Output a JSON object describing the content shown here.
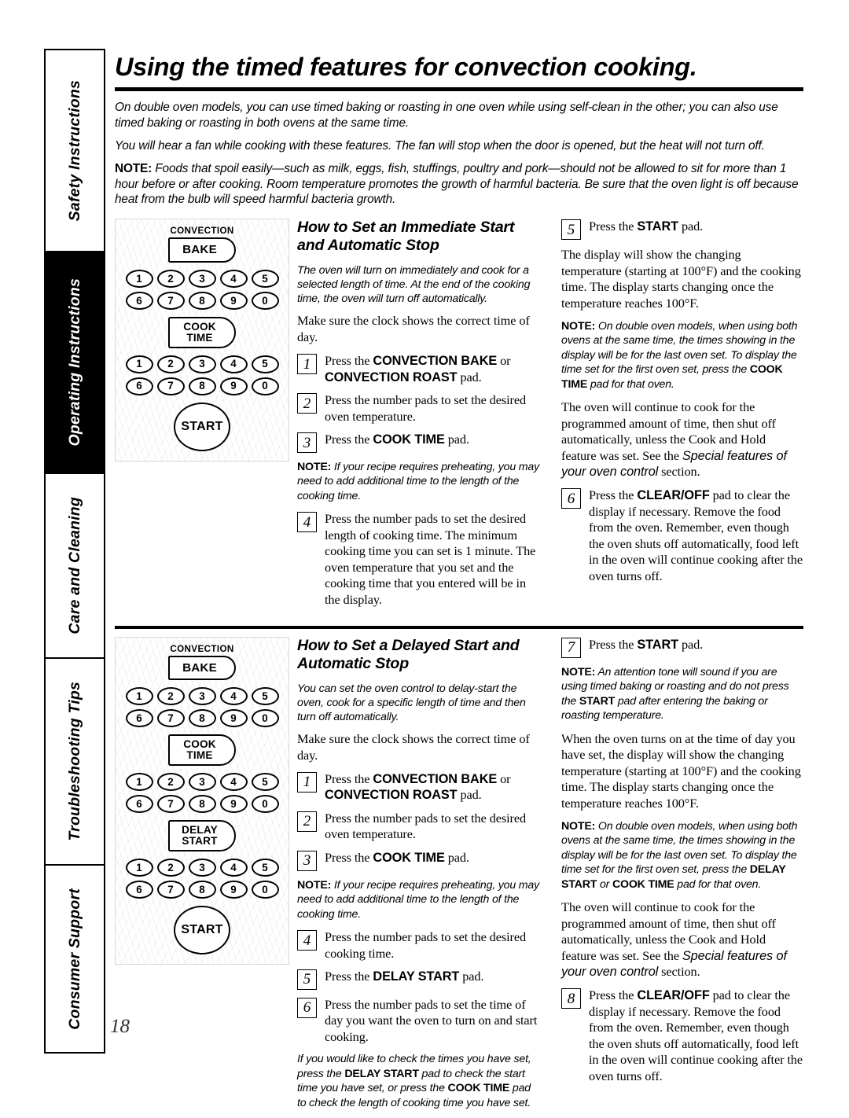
{
  "sidebar": {
    "tabs": [
      {
        "label": "Safety Instructions",
        "active": false
      },
      {
        "label": "Operating Instructions",
        "active": true
      },
      {
        "label": "Care and Cleaning",
        "active": false
      },
      {
        "label": "Troubleshooting Tips",
        "active": false
      },
      {
        "label": "Consumer Support",
        "active": false
      }
    ]
  },
  "page": {
    "title": "Using the timed features for convection cooking.",
    "number": "18"
  },
  "intro": {
    "p1": "On double oven models, you can use timed baking or roasting in one oven while using self-clean in the other; you can also use timed baking or roasting in both ovens at the same time.",
    "p2": "You will hear a fan while cooking with these features. The fan will stop when the door is opened, but the heat will not turn off.",
    "note_label": "NOTE:",
    "note_body": "Foods that spoil easily—such as milk, eggs, fish, stuffings, poultry and pork—should not be allowed to sit for more than 1 hour before or after cooking. Room temperature promotes the growth of harmful bacteria. Be sure that the oven light is off because heat from the bulb will speed harmful bacteria growth."
  },
  "section1": {
    "heading": "How to Set an Immediate Start and Automatic Stop",
    "intro_italic": "The oven will turn on immediately and cook for a selected length of time. At the end of the cooking time, the oven will turn off automatically.",
    "clock_line": "Make sure the clock shows the correct time of day.",
    "step1_num": "1",
    "step1_a": "Press the ",
    "step1_bold1": "CONVECTION BAKE",
    "step1_b": " or ",
    "step1_bold2": "CONVECTION ROAST",
    "step1_c": " pad.",
    "step2_num": "2",
    "step2_text": "Press the number pads to set the desired oven temperature.",
    "step3_num": "3",
    "step3_a": "Press the ",
    "step3_bold": "COOK TIME",
    "step3_b": " pad.",
    "note1_label": "NOTE:",
    "note1_body": "If your recipe requires preheating, you may need to add additional time to the length of the cooking time.",
    "step4_num": "4",
    "step4_text": "Press the number pads to set the desired length of cooking time. The minimum cooking time you can set is 1 minute. The oven temperature that you set and the cooking time that you entered will be in the display.",
    "step5_num": "5",
    "step5_a": "Press the ",
    "step5_bold": "START",
    "step5_b": " pad.",
    "para_display": "The display will show the changing temperature (starting at 100°F) and the cooking time. The display starts changing once the temperature reaches 100°F.",
    "note2_label": "NOTE:",
    "note2_a": "On double oven models, when using both ovens at the same time, the times showing in the display will be for the last oven set. To display the time set for the first oven set, press the ",
    "note2_bold": "COOK TIME",
    "note2_b": " pad for that oven.",
    "para_continue_a": "The oven will continue to cook for the programmed amount of time, then shut off automatically, unless the Cook and Hold feature was set. See the ",
    "para_continue_italic": "Special features of your oven control",
    "para_continue_b": " section.",
    "step6_num": "6",
    "step6_a": "Press the ",
    "step6_bold": "CLEAR/OFF",
    "step6_b": " pad to clear the display if necessary. Remove the food from the oven. Remember, even though the oven shuts off automatically, food left in the oven will continue cooking after the oven turns off."
  },
  "section2": {
    "heading": "How to Set a Delayed Start and Automatic Stop",
    "intro_italic": "You can set the oven control to delay-start the oven, cook for a specific length of time and then turn off automatically.",
    "clock_line": "Make sure the clock shows the correct time of day.",
    "step1_num": "1",
    "step1_a": "Press the ",
    "step1_bold1": "CONVECTION BAKE",
    "step1_b": " or ",
    "step1_bold2": "CONVECTION ROAST",
    "step1_c": " pad.",
    "step2_num": "2",
    "step2_text": "Press the number pads to set the desired oven temperature.",
    "step3_num": "3",
    "step3_a": "Press the ",
    "step3_bold": "COOK TIME",
    "step3_b": " pad.",
    "note1_label": "NOTE:",
    "note1_body": "If your recipe requires preheating, you may need to add additional time to the length of the cooking time.",
    "step4_num": "4",
    "step4_text": "Press the number pads to set the desired cooking time.",
    "step5_num": "5",
    "step5_a": "Press the ",
    "step5_bold": "DELAY START",
    "step5_b": " pad.",
    "step6_num": "6",
    "step6_text": "Press the number pads to set the time of day you want the oven to turn on and start cooking.",
    "check_a": "If you would like to check the times you have set, press the ",
    "check_bold1": "DELAY START",
    "check_b": " pad to check the start time you have set, or press the ",
    "check_bold2": "COOK TIME",
    "check_c": " pad to check the length of cooking time you have set.",
    "step7_num": "7",
    "step7_a": "Press the ",
    "step7_bold": "START",
    "step7_b": " pad.",
    "note2_label": "NOTE:",
    "note2_a": "An attention tone will sound if you are using timed baking or roasting and do not press the ",
    "note2_bold": "START",
    "note2_b": " pad after entering the baking or roasting temperature.",
    "para_when": "When the oven turns on at the time of day you have set, the display will show the changing temperature (starting at 100°F) and the cooking time. The display starts changing once the temperature reaches 100°F.",
    "note3_label": "NOTE:",
    "note3_a": "On double oven models, when using both ovens at the same time, the times showing in the display will be for the last oven set. To display the time set for the first oven set, press the ",
    "note3_bold1": "DELAY START",
    "note3_b": " or ",
    "note3_bold2": "COOK TIME",
    "note3_c": " pad for that oven.",
    "para_continue_a": "The oven will continue to cook for the programmed amount of time, then shut off automatically, unless the Cook and Hold feature was set. See the ",
    "para_continue_italic": "Special features of your oven control",
    "para_continue_b": " section.",
    "step8_num": "8",
    "step8_a": "Press the ",
    "step8_bold": "CLEAR/OFF",
    "step8_b": " pad to clear the display if necessary. Remove the food from the oven. Remember, even though the oven shuts off automatically, food left in the oven will continue cooking after the oven turns off."
  },
  "control_panel_1": {
    "caption": "CONVECTION",
    "bake_label": "BAKE",
    "cook_time_label": "COOK\nTIME",
    "cook_time_line1": "COOK",
    "cook_time_line2": "TIME",
    "start_label": "START",
    "keys_row_a": [
      "1",
      "2",
      "3",
      "4",
      "5"
    ],
    "keys_row_b": [
      "6",
      "7",
      "8",
      "9",
      "0"
    ]
  },
  "control_panel_2": {
    "caption": "CONVECTION",
    "bake_label": "BAKE",
    "cook_time_line1": "COOK",
    "cook_time_line2": "TIME",
    "delay_start_line1": "DELAY",
    "delay_start_line2": "START",
    "start_label": "START",
    "keys_row_a": [
      "1",
      "2",
      "3",
      "4",
      "5"
    ],
    "keys_row_b": [
      "6",
      "7",
      "8",
      "9",
      "0"
    ]
  }
}
